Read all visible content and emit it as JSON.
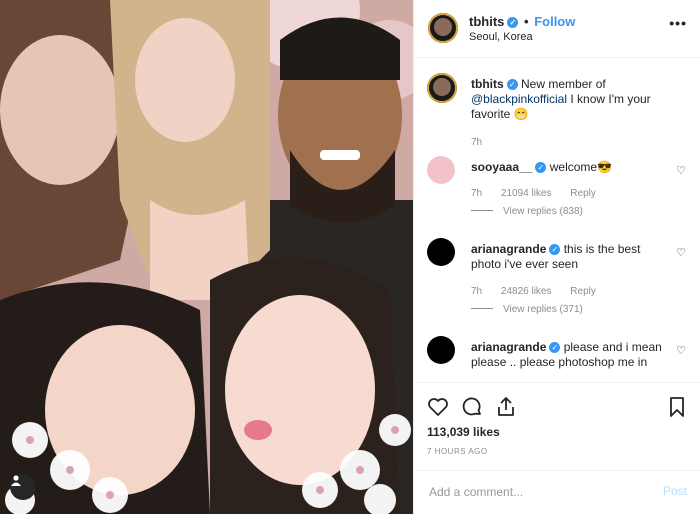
{
  "post": {
    "author": "tbhits",
    "follow_label": "Follow",
    "location": "Seoul, Korea",
    "more_glyph": "•••"
  },
  "caption": {
    "user": "tbhits",
    "pre_text": "New member of",
    "mention": "@blackpinkofficial",
    "post_text": "I know I'm your favorite 😁",
    "age": "7h"
  },
  "comments": [
    {
      "user": "sooyaaa__",
      "text": "welcome😎",
      "age": "7h",
      "likes": "21094 likes",
      "reply_label": "Reply",
      "view_replies": "View replies (838)"
    },
    {
      "user": "arianagrande",
      "text": "this is the best photo i've ever seen",
      "age": "7h",
      "likes": "24826 likes",
      "reply_label": "Reply",
      "view_replies": "View replies (371)"
    },
    {
      "user": "arianagrande",
      "text": "please and i mean please .. please photoshop me in"
    }
  ],
  "stats": {
    "likes": "113,039 likes",
    "time": "7 HOURS AGO"
  },
  "add_comment": {
    "placeholder": "Add a comment...",
    "post_label": "Post"
  },
  "icons": {
    "heart": "heart-icon",
    "comment": "comment-icon",
    "share": "share-icon",
    "save": "bookmark-icon"
  }
}
